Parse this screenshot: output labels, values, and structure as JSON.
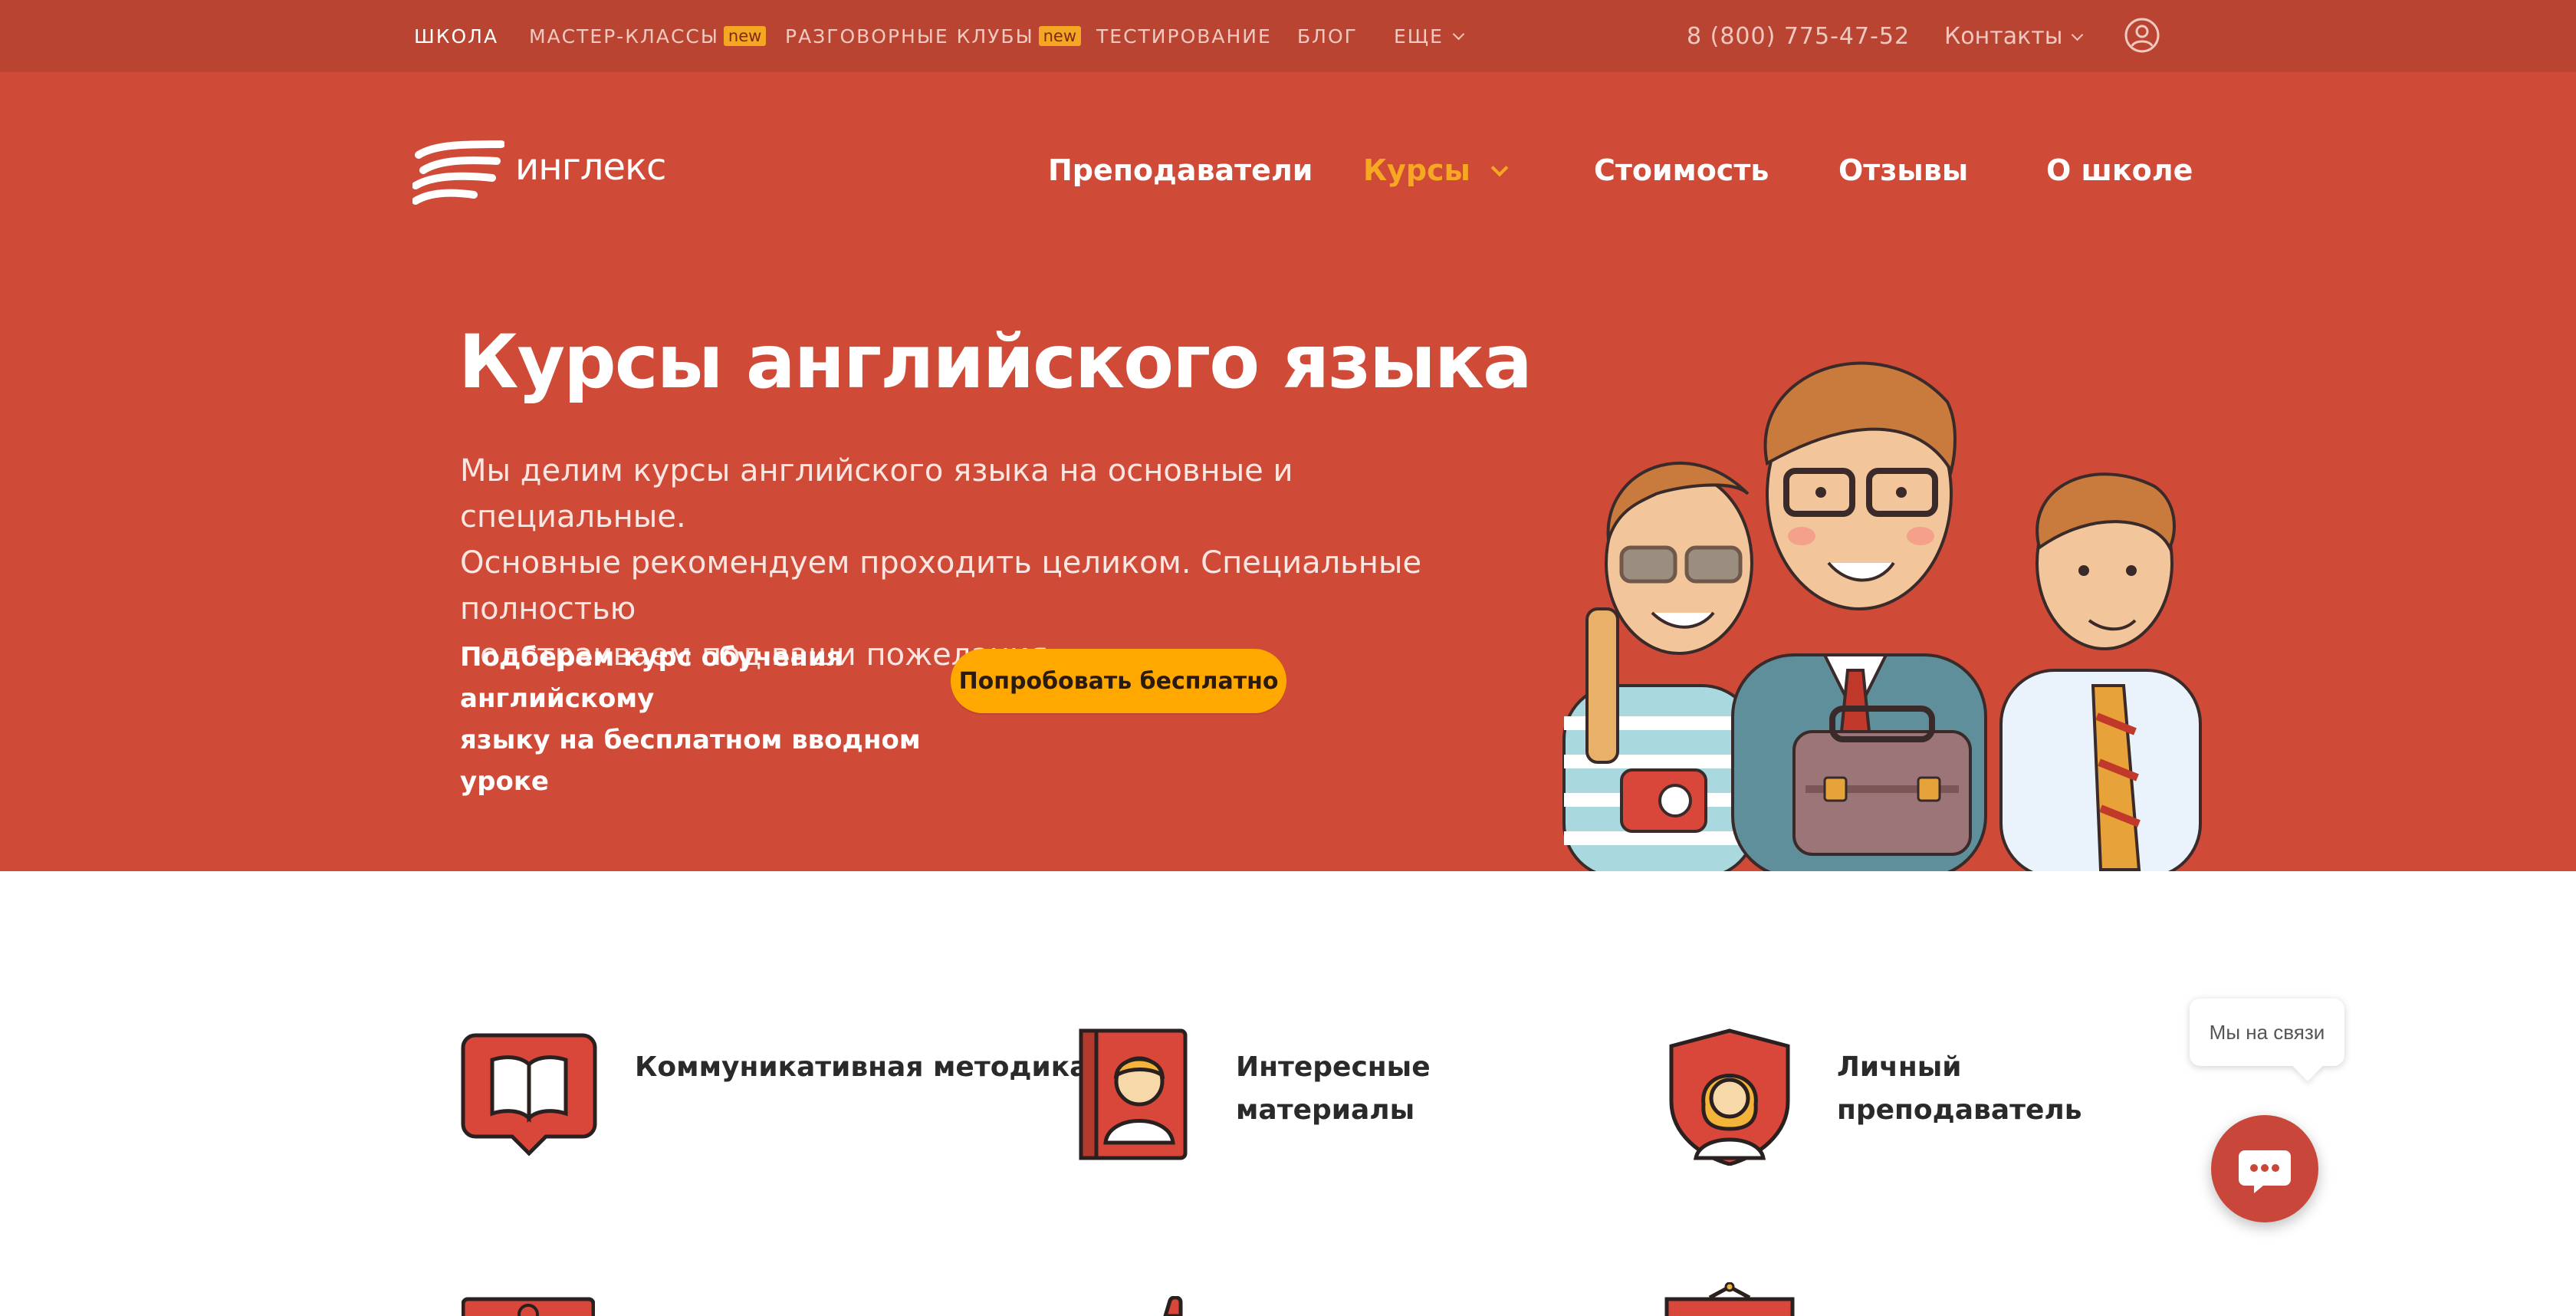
{
  "colors": {
    "topbar": "#b94431",
    "hero": "#cf4a37",
    "accent": "#ffa800",
    "active_nav": "#f7a823",
    "chat": "#c9473a"
  },
  "topbar": {
    "items": [
      {
        "label": "ШКОЛА"
      },
      {
        "label": "МАСТЕР-КЛАССЫ",
        "badge": "new"
      },
      {
        "label": "РАЗГОВОРНЫЕ КЛУБЫ",
        "badge": "new"
      },
      {
        "label": "ТЕСТИРОВАНИЕ"
      },
      {
        "label": "БЛОГ"
      },
      {
        "label": "ЕЩЕ"
      }
    ],
    "phone": "8 (800) 775-47-52",
    "contacts": "Контакты",
    "user_icon": "user-circle-icon"
  },
  "header": {
    "logo_text": "инглекс",
    "nav": [
      {
        "label": "Преподаватели"
      },
      {
        "label": "Курсы"
      },
      {
        "label": "Стоимость"
      },
      {
        "label": "Отзывы"
      },
      {
        "label": "О школе"
      }
    ]
  },
  "hero": {
    "title": "Курсы английского языка",
    "desc_line1": "Мы делим курсы английского языка на основные и специальные.",
    "desc_line2": "Основные рекомендуем проходить целиком. Специальные полностью",
    "desc_line3": "подстраиваем под ваши пожелания.",
    "sub_line1": "Подберем курс обучения английскому",
    "sub_line2": "языку на бесплатном вводном уроке",
    "cta": "Попробовать бесплатно"
  },
  "features": [
    {
      "icon": "book-chat-icon",
      "line1": "Коммуникативная методика",
      "line2": ""
    },
    {
      "icon": "student-book-icon",
      "line1": "Интересные",
      "line2": "материалы"
    },
    {
      "icon": "teacher-shield-icon",
      "line1": "Личный",
      "line2": "преподаватель"
    }
  ],
  "chat": {
    "tooltip": "Мы на связи",
    "icon": "chat-icon"
  }
}
